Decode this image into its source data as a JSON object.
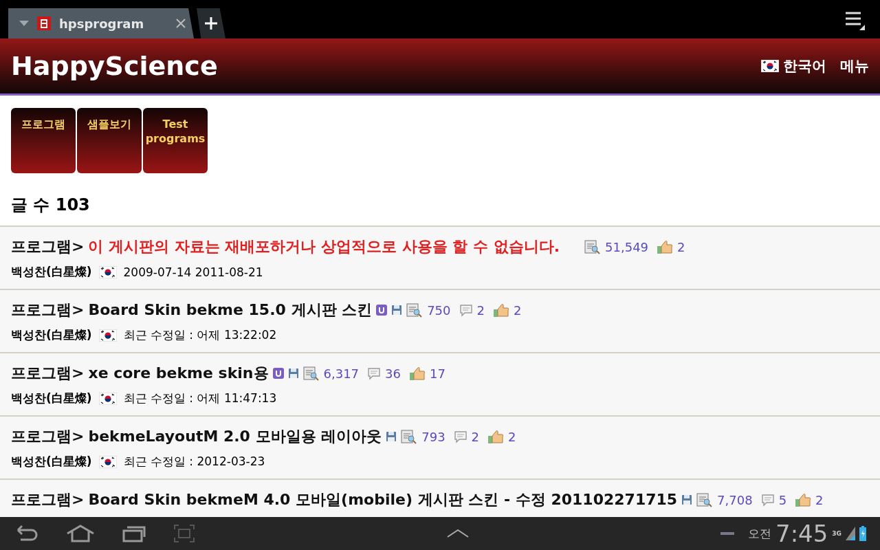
{
  "browser_tab": {
    "title": "hpsprogram",
    "selected": true
  },
  "header": {
    "title": "HappyScience",
    "language": "한국어",
    "menu": "메뉴"
  },
  "categories": [
    {
      "label": "프로그램"
    },
    {
      "label": "샘플보기"
    },
    {
      "label": "Test programs"
    }
  ],
  "post_count": "글 수 103",
  "posts": [
    {
      "category": "프로그램>",
      "title": "이 게시판의 자료는 재배포하거나 상업적으로 사용을 할 수 없습니다.",
      "notice": true,
      "user_badge": false,
      "attachment": false,
      "views": "51,549",
      "likes": "2",
      "author": "백성찬(白星燦)",
      "date": "2009-07-14 2011-08-21"
    },
    {
      "category": "프로그램>",
      "title": "Board Skin bekme 15.0 게시판 스킨",
      "notice": false,
      "user_badge": true,
      "attachment": true,
      "views": "750",
      "comments": "2",
      "likes": "2",
      "author": "백성찬(白星燦)",
      "date": "최근 수정일 : 어제 13:22:02"
    },
    {
      "category": "프로그램>",
      "title": "xe core bekme skin용",
      "notice": false,
      "user_badge": true,
      "attachment": true,
      "views": "6,317",
      "comments": "36",
      "likes": "17",
      "author": "백성찬(白星燦)",
      "date": "최근 수정일 : 어제 11:47:13"
    },
    {
      "category": "프로그램>",
      "title": "bekmeLayoutM 2.0 모바일용 레이아웃",
      "notice": false,
      "user_badge": false,
      "attachment": true,
      "views": "793",
      "comments": "2",
      "likes": "2",
      "author": "백성찬(白星燦)",
      "date": "최근 수정일 : 2012-03-23"
    },
    {
      "category": "프로그램>",
      "title": "Board Skin bekmeM 4.0 모바일(mobile) 게시판 스킨 - 수정 201102271715",
      "notice": false,
      "user_badge": false,
      "attachment": true,
      "views": "7,708",
      "comments": "5",
      "likes": "2"
    }
  ],
  "status_bar": {
    "ampm": "오전",
    "time": "7:45",
    "network": "3G"
  }
}
